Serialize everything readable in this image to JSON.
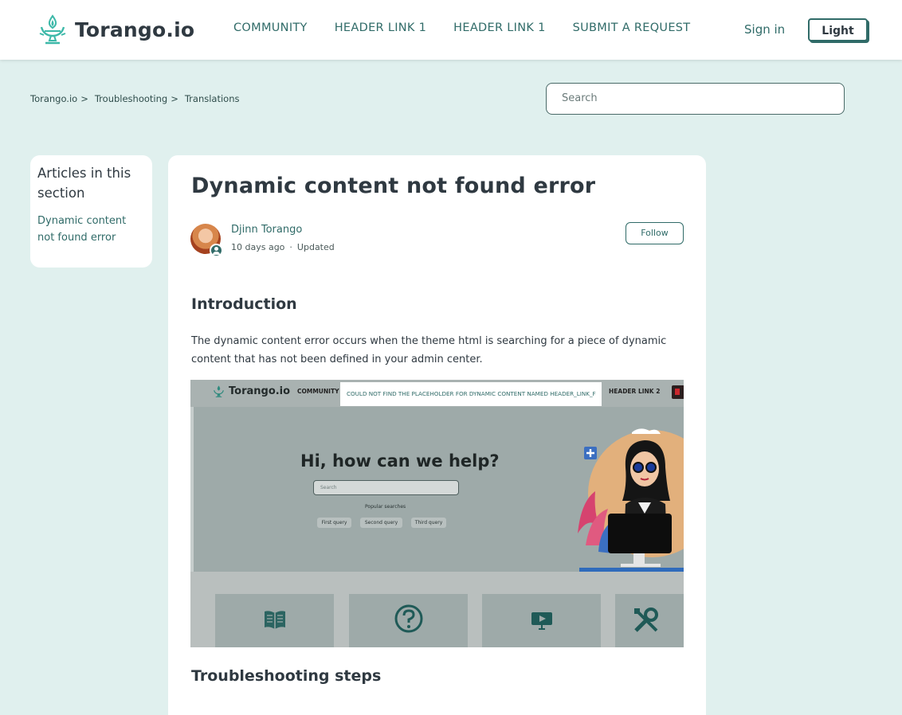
{
  "header": {
    "brand": "Torango.io",
    "nav": [
      "COMMUNITY",
      "HEADER LINK 1",
      "HEADER LINK 1",
      "SUBMIT A REQUEST"
    ],
    "signin": "Sign in",
    "theme_button": "Light"
  },
  "breadcrumb": [
    "Torango.io",
    "Troubleshooting",
    "Translations"
  ],
  "breadcrumb_sep": ">",
  "search": {
    "placeholder": "Search"
  },
  "sidebar": {
    "heading": "Articles in this section",
    "items": [
      "Dynamic content not found error"
    ]
  },
  "article": {
    "title": "Dynamic content not found error",
    "author": "Djinn Torango",
    "posted": "10 days ago",
    "dot": "·",
    "status": "Updated",
    "follow_label": "Follow",
    "section1_title": "Introduction",
    "section1_text": "The dynamic content error occurs when the theme html is searching for a piece of dynamic content that has not been defined in your admin center.",
    "section2_title": "Troubleshooting steps"
  },
  "screenshot": {
    "brand": "Torango.io",
    "nav_left": "COMMUNITY",
    "error_text": "COULD NOT FIND THE PLACEHOLDER FOR DYNAMIC CONTENT NAMED HEADER_LINK_F",
    "nav_right": "HEADER LINK 2",
    "hero_title": "Hi, how can we help?",
    "search_placeholder": "Search",
    "popular_label": "Popular searches",
    "queries": [
      "First query",
      "Second query",
      "Third query"
    ],
    "card_icons": [
      "book-icon",
      "question-icon",
      "video-icon",
      "tools-icon"
    ]
  },
  "colors": {
    "accent": "#306b68",
    "page_bg": "#e0f0ee",
    "text": "#2f3941",
    "logo": "#3cb8a8"
  }
}
